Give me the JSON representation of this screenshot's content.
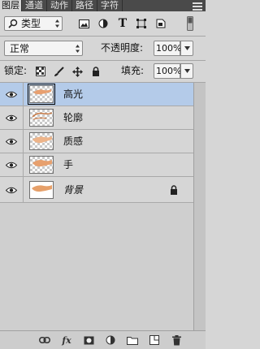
{
  "tabs": [
    "图层",
    "通道",
    "动作",
    "路径",
    "字符"
  ],
  "filter": {
    "kind_label": "类型"
  },
  "blend": {
    "mode": "正常",
    "opacity_label": "不透明度:",
    "opacity_value": "100%"
  },
  "lock": {
    "label": "锁定:",
    "fill_label": "填充:",
    "fill_value": "100%"
  },
  "layers": [
    {
      "name": "高光",
      "selected": true
    },
    {
      "name": "轮廓"
    },
    {
      "name": "质感"
    },
    {
      "name": "手"
    },
    {
      "name": "背景",
      "locked": true
    }
  ],
  "bottom": {
    "fx_label": "fx"
  }
}
